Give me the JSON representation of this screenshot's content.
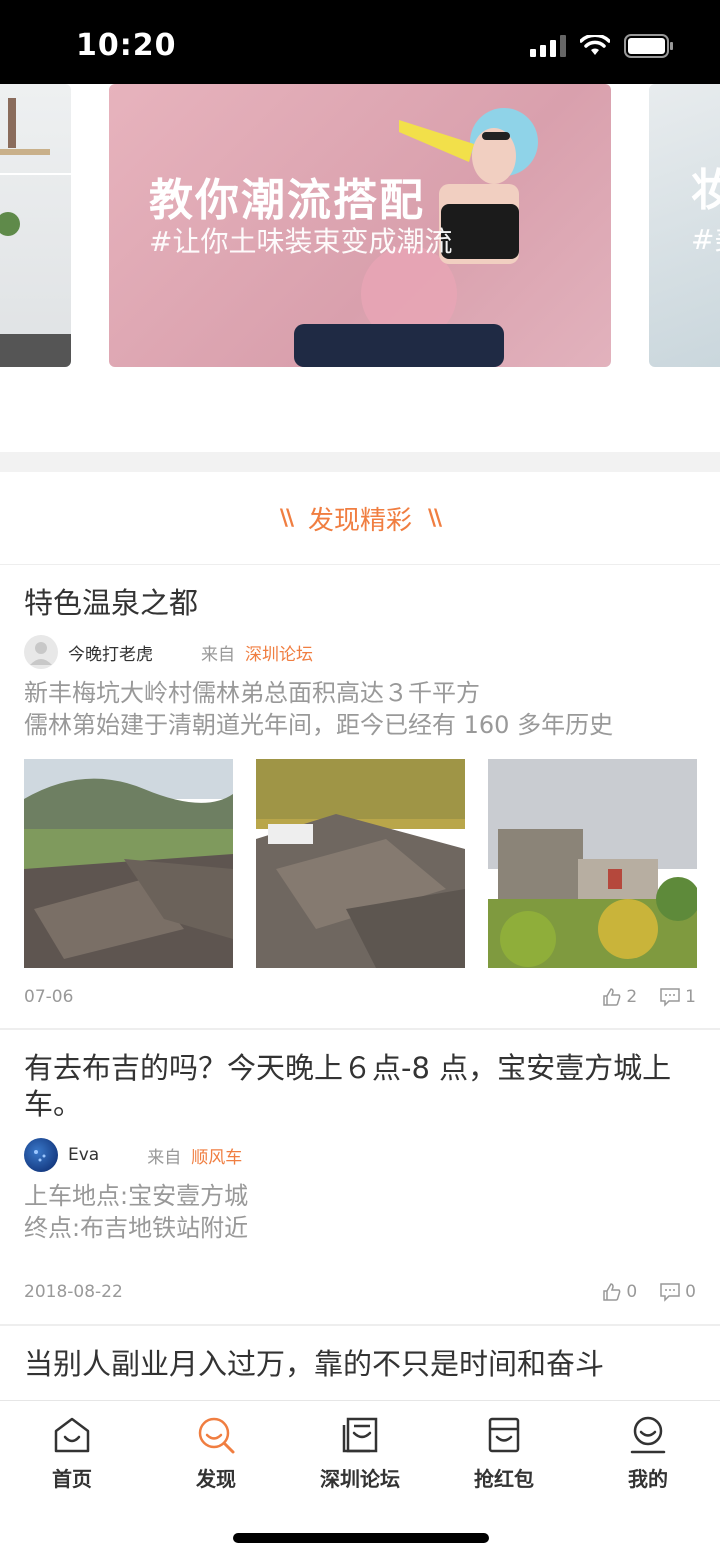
{
  "status_bar": {
    "time": "10:20"
  },
  "banners": [
    {
      "title": "",
      "subtitle": ""
    },
    {
      "title": "教你潮流搭配",
      "subtitle": "#让你土味装束变成潮流"
    },
    {
      "title": "妆",
      "subtitle": "#美"
    }
  ],
  "section": {
    "title": "发现精彩"
  },
  "posts": [
    {
      "title": "特色温泉之都",
      "author": "今晚打老虎",
      "from_label": "来自",
      "forum": "深圳论坛",
      "excerpt": [
        "新丰梅坑大岭村儒林弟总面积高达３千平方",
        "儒林第始建于清朝道光年间，距今已经有 160 多年历史"
      ],
      "date": "07-06",
      "likes": "2",
      "comments": "1"
    },
    {
      "title": "有去布吉的吗？今天晚上６点-8 点，宝安壹方城上车。",
      "author": "Eva",
      "from_label": "来自",
      "forum": "顺风车",
      "excerpt": [
        "上车地点:宝安壹方城",
        "终点:布吉地铁站附近"
      ],
      "date": "2018-08-22",
      "likes": "0",
      "comments": "0"
    },
    {
      "title": "当别人副业月入过万，靠的不只是时间和奋斗"
    }
  ],
  "tabbar": {
    "tabs": [
      {
        "label": "首页",
        "icon": "home-icon",
        "active": false
      },
      {
        "label": "发现",
        "icon": "discover-icon",
        "active": true
      },
      {
        "label": "深圳论坛",
        "icon": "forum-icon",
        "active": false
      },
      {
        "label": "抢红包",
        "icon": "red-packet-icon",
        "active": false
      },
      {
        "label": "我的",
        "icon": "profile-icon",
        "active": false
      }
    ]
  },
  "colors": {
    "accent": "#f07e41",
    "text": "#333333",
    "muted": "#999999"
  }
}
